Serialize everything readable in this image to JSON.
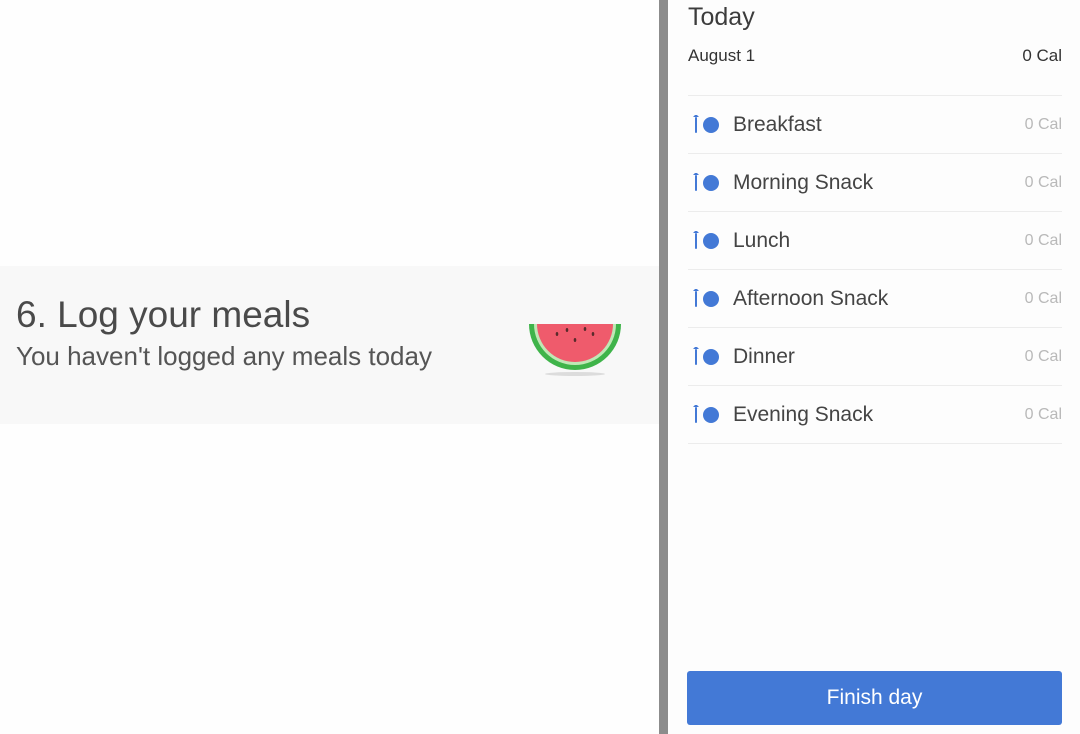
{
  "tip": {
    "title": "6. Log your meals",
    "subtitle": "You haven't logged any meals today",
    "illustration": "watermelon-icon"
  },
  "day": {
    "title": "Today",
    "date": "August 1",
    "total": "0 Cal"
  },
  "meals": [
    {
      "name": "Breakfast",
      "calories": "0 Cal",
      "icon": "utensils-plate-icon"
    },
    {
      "name": "Morning Snack",
      "calories": "0 Cal",
      "icon": "utensils-plate-icon"
    },
    {
      "name": "Lunch",
      "calories": "0 Cal",
      "icon": "utensils-plate-icon"
    },
    {
      "name": "Afternoon Snack",
      "calories": "0 Cal",
      "icon": "utensils-plate-icon"
    },
    {
      "name": "Dinner",
      "calories": "0 Cal",
      "icon": "utensils-plate-icon"
    },
    {
      "name": "Evening Snack",
      "calories": "0 Cal",
      "icon": "utensils-plate-icon"
    }
  ],
  "actions": {
    "finish_label": "Finish day"
  },
  "colors": {
    "accent": "#4379d6",
    "watermelon_flesh": "#ef5b6c",
    "watermelon_rind": "#3fb44a"
  }
}
